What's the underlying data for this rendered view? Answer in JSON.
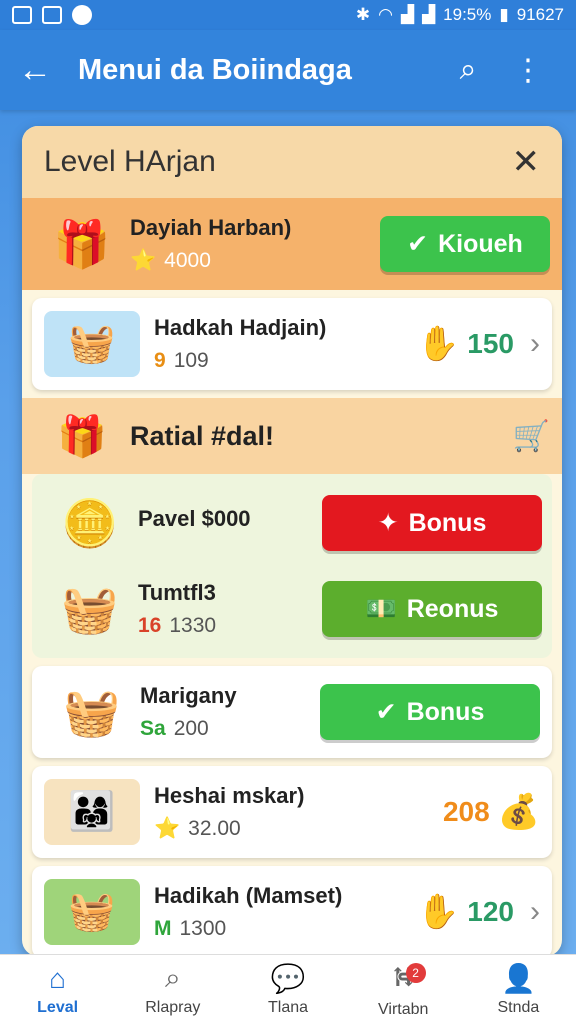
{
  "status": {
    "battery": "19:5%",
    "time": "91627"
  },
  "appbar": {
    "title": "Menui da Boiindaga"
  },
  "sheet": {
    "title": "Level HArjan"
  },
  "promo": {
    "name": "Dayiah Harban)",
    "value": "4000",
    "button": "Kioueh"
  },
  "card1": {
    "name": "Hadkah Hadjain)",
    "prefix": "9",
    "value": "109",
    "amount": "150"
  },
  "banner": {
    "text": "Ratial #dal!"
  },
  "green_rows": [
    {
      "name": "Pavel $000",
      "button": "Bonus"
    },
    {
      "name": "Tumtfl3",
      "prefix": "16",
      "value": "1330",
      "button": "Reonus"
    }
  ],
  "card2": {
    "name": "Marigany",
    "prefix": "Sa",
    "value": "200",
    "button": "Bonus"
  },
  "card3": {
    "name": "Heshai mskar)",
    "value": "32.00",
    "amount": "208"
  },
  "card4": {
    "name": "Hadikah (Mamset)",
    "prefix": "M",
    "value": "1300",
    "amount": "120"
  },
  "nav": [
    {
      "label": "Leval",
      "icon": "home-icon"
    },
    {
      "label": "Rlapray",
      "icon": "search-icon"
    },
    {
      "label": "Tlana",
      "icon": "chat-icon"
    },
    {
      "label": "Virtabn",
      "icon": "road-icon",
      "badge": "2"
    },
    {
      "label": "Stnda",
      "icon": "profile-icon"
    }
  ],
  "colors": {
    "accent": "#3384dc",
    "green": "#3cc34c",
    "red": "#e3181f"
  }
}
